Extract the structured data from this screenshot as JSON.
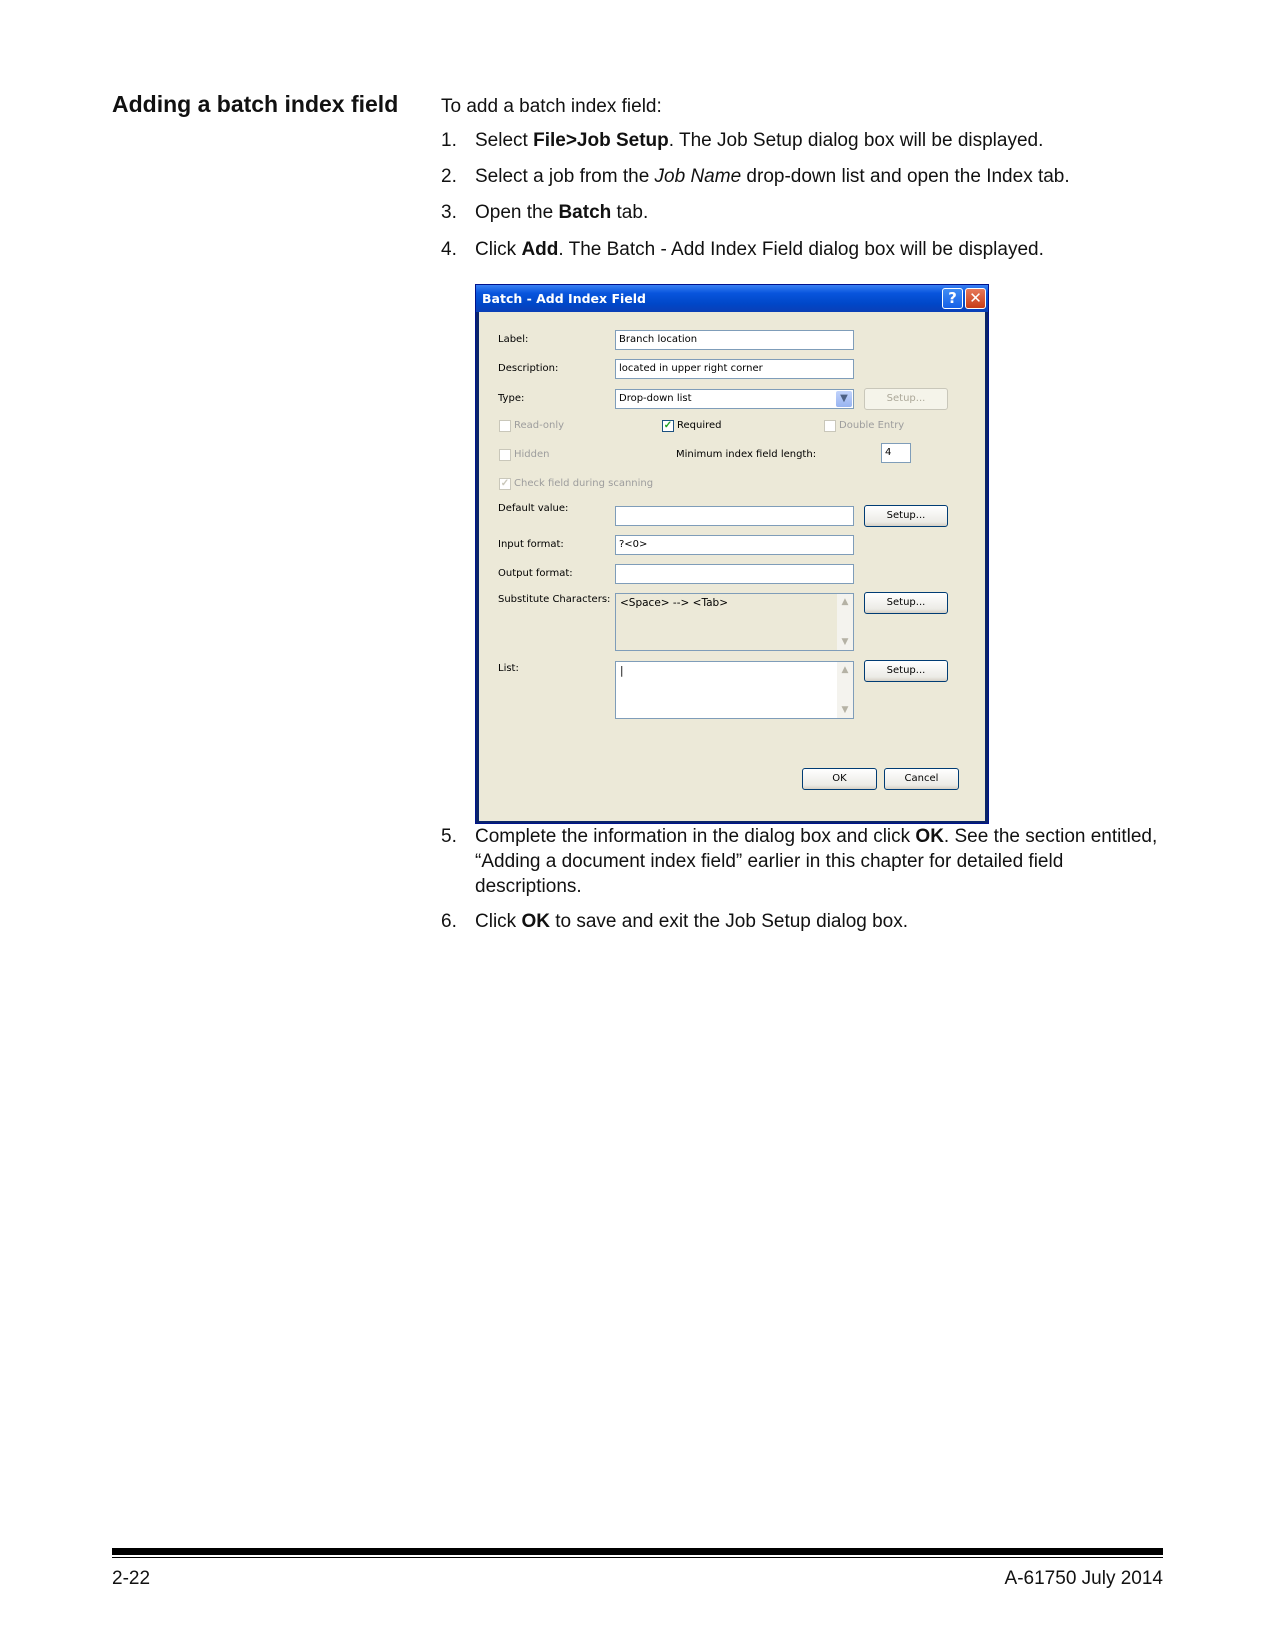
{
  "section_title": "Adding a batch index field",
  "intro": "To add a batch index field:",
  "steps": [
    {
      "num": "1.",
      "parts": [
        {
          "t": "Select "
        },
        {
          "t": "File>Job Setup",
          "b": true
        },
        {
          "t": ". The Job Setup dialog box will be displayed."
        }
      ]
    },
    {
      "num": "2.",
      "parts": [
        {
          "t": "Select a job from the "
        },
        {
          "t": "Job Name",
          "i": true
        },
        {
          "t": " drop-down list and open the Index tab."
        }
      ]
    },
    {
      "num": "3.",
      "parts": [
        {
          "t": "Open the "
        },
        {
          "t": "Batch",
          "b": true
        },
        {
          "t": " tab."
        }
      ]
    },
    {
      "num": "4.",
      "parts": [
        {
          "t": "Click "
        },
        {
          "t": "Add",
          "b": true
        },
        {
          "t": ". The Batch - Add Index Field dialog box will be displayed."
        }
      ]
    },
    {
      "num": "5.",
      "parts": [
        {
          "t": "Complete the information in the dialog box and click "
        },
        {
          "t": "OK",
          "b": true
        },
        {
          "t": ". See the section entitled, “Adding a document index field” earlier in this chapter for detailed field descriptions."
        }
      ]
    },
    {
      "num": "6.",
      "parts": [
        {
          "t": "Click "
        },
        {
          "t": "OK",
          "b": true
        },
        {
          "t": " to save and exit the Job Setup dialog box."
        }
      ]
    }
  ],
  "dialog": {
    "title": "Batch - Add Index Field",
    "help_glyph": "?",
    "close_glyph": "✕",
    "labels": {
      "label": "Label:",
      "description": "Description:",
      "type": "Type:",
      "read_only": "Read-only",
      "required": "Required",
      "double_entry": "Double Entry",
      "hidden": "Hidden",
      "min_length": "Minimum index field length:",
      "check_field": "Check field during scanning",
      "default_value": "Default value:",
      "input_format": "Input format:",
      "output_format": "Output format:",
      "substitute": "Substitute Characters:",
      "list": "List:"
    },
    "values": {
      "label": "Branch location",
      "description": "located in upper right corner",
      "type": "Drop-down list",
      "min_length": "4",
      "default_value": "",
      "input_format": "?<0>",
      "output_format": "",
      "substitute": "<Space> --> <Tab>",
      "list": "|"
    },
    "checkboxes": {
      "read_only": false,
      "required": true,
      "double_entry": false,
      "hidden": false,
      "check_field": true
    },
    "buttons": {
      "setup": "Setup...",
      "ok": "OK",
      "cancel": "Cancel"
    }
  },
  "footer": {
    "page": "2-22",
    "doc": "A-61750  July 2014"
  }
}
